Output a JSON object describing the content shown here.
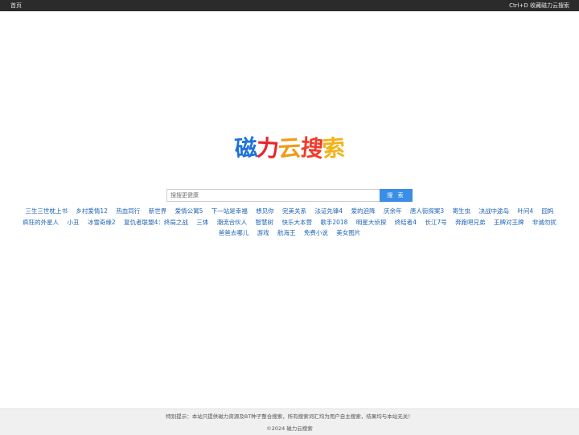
{
  "topbar": {
    "home_label": "首页",
    "bookmark_hint": "Ctrl+D 收藏磁力云搜索"
  },
  "logo": {
    "chars": [
      "磁",
      "力",
      "云",
      "搜",
      "索"
    ],
    "colors": [
      "#1e73d6",
      "#e8262b",
      "#f19a16",
      "#ef3b2c",
      "#f2b31a"
    ]
  },
  "search": {
    "placeholder": "搜搜更健康",
    "button_label": "搜 索"
  },
  "hot_links": [
    "三生三世枕上书",
    "乡村爱情12",
    "热血同行",
    "新世界",
    "爱情公寓5",
    "下一站是幸福",
    "想见你",
    "完美关系",
    "法证先锋4",
    "爱的迫降",
    "庆余年",
    "唐人街探案3",
    "寄生虫",
    "决战中途岛",
    "叶问4",
    "囧妈",
    "疯狂的外星人",
    "小丑",
    "冰雪奇缘2",
    "复仇者联盟4：终局之战",
    "三体",
    "潮流合伙人",
    "智慧树",
    "快乐大本营",
    "歌手2018",
    "明星大侦探",
    "终结者4",
    "长江7号",
    "奔跑吧兄弟",
    "王牌对王牌",
    "非诚勿扰",
    "爸爸去哪儿",
    "游戏",
    "航海王",
    "免费小说",
    "美女图片"
  ],
  "footer": {
    "notice": "特别提示：本站只提供磁力资源及BT种子整合搜索，所有搜索词汇均为用户自主搜索，结果均与本站无关！",
    "copyright": "©2024 磁力云搜索"
  },
  "colors": {
    "topbar_bg": "#2b2b2b",
    "link": "#1b62b4",
    "button_bg": "#3a8ee6",
    "footer_bg": "#f0f0f0"
  }
}
